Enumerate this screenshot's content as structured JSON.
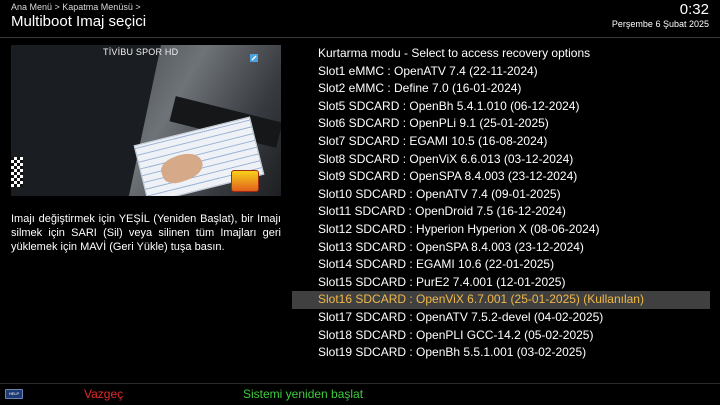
{
  "header": {
    "breadcrumb": "Ana Menü > Kapatma Menüsü >",
    "title": "Multiboot Imaj seçici",
    "clock": "0:32",
    "date": "Perşembe 6 Şubat 2025"
  },
  "preview": {
    "channel_logo": "TİVİBU SPOR HD"
  },
  "help_text": "Imajı değiştirmek için YEŞİL (Yeniden Başlat), bir Imajı silmek için SARI (Sil) veya silinen tüm Imajları geri yüklemek için MAVİ (Geri Yükle) tuşa basın.",
  "slots": [
    {
      "label": "Kurtarma modu - Select to access recovery options"
    },
    {
      "label": "Slot1 eMMC : OpenATV 7.4 (22-11-2024)"
    },
    {
      "label": "Slot2 eMMC : Define 7.0 (16-01-2024)"
    },
    {
      "label": "Slot5 SDCARD : OpenBh 5.4.1.010 (06-12-2024)"
    },
    {
      "label": "Slot6 SDCARD : OpenPLi 9.1 (25-01-2025)"
    },
    {
      "label": "Slot7 SDCARD : EGAMI 10.5 (16-08-2024)"
    },
    {
      "label": "Slot8 SDCARD : OpenViX 6.6.013 (03-12-2024)"
    },
    {
      "label": "Slot9 SDCARD : OpenSPA 8.4.003 (23-12-2024)"
    },
    {
      "label": "Slot10 SDCARD : OpenATV 7.4 (09-01-2025)"
    },
    {
      "label": "Slot11 SDCARD : OpenDroid 7.5 (16-12-2024)"
    },
    {
      "label": "Slot12 SDCARD : Hyperion Hyperion X (08-06-2024)"
    },
    {
      "label": "Slot13 SDCARD : OpenSPA 8.4.003 (23-12-2024)"
    },
    {
      "label": "Slot14 SDCARD : EGAMI 10.6 (22-01-2025)"
    },
    {
      "label": "Slot15 SDCARD : PurE2 7.4.001 (12-01-2025)"
    },
    {
      "label": "Slot16 SDCARD : OpenViX 6.7.001 (25-01-2025)  (Kullanılan)",
      "selected": true
    },
    {
      "label": "Slot17 SDCARD : OpenATV 7.5.2-devel (04-02-2025)"
    },
    {
      "label": "Slot18 SDCARD : OpenPLI GCC-14.2 (05-02-2025)"
    },
    {
      "label": "Slot19 SDCARD : OpenBh 5.5.1.001 (03-02-2025)"
    }
  ],
  "footer": {
    "help_label": "HELP",
    "cancel_label": "Vazgeç",
    "restart_label": "Sistemi yeniden başlat"
  },
  "colors": {
    "selected_text": "#f0b848",
    "selected_bg": "#404040",
    "red_key": "#e22a2a",
    "green_key": "#3ecb3e"
  }
}
